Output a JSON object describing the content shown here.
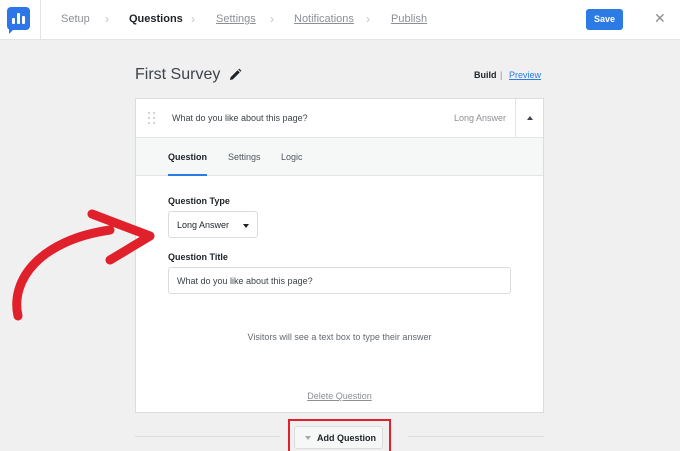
{
  "topbar": {
    "steps": [
      {
        "label": "Setup"
      },
      {
        "label": "Questions"
      },
      {
        "label": "Settings"
      },
      {
        "label": "Notifications"
      },
      {
        "label": "Publish"
      }
    ],
    "save_label": "Save",
    "close_glyph": "✕"
  },
  "survey": {
    "title": "First Survey",
    "build_label": "Build",
    "divider": "|",
    "preview_label": "Preview"
  },
  "question": {
    "header_text": "What do you like about this page?",
    "type_label": "Long Answer",
    "tabs": [
      {
        "label": "Question"
      },
      {
        "label": "Settings"
      },
      {
        "label": "Logic"
      }
    ],
    "type_field_label": "Question Type",
    "type_value": "Long Answer",
    "title_field_label": "Question Title",
    "title_value": "What do you like about this page?",
    "helper_text": "Visitors will see a text box to type their answer",
    "delete_label": "Delete Question"
  },
  "add_question_label": "Add Question",
  "colors": {
    "accent": "#2c7be5",
    "highlight": "#e0202a"
  },
  "icons": [
    "app-logo-icon",
    "chevron-right-icon",
    "close-icon",
    "pencil-icon",
    "drag-handle-icon",
    "caret-up-icon",
    "caret-down-icon",
    "arrow-annotation"
  ]
}
